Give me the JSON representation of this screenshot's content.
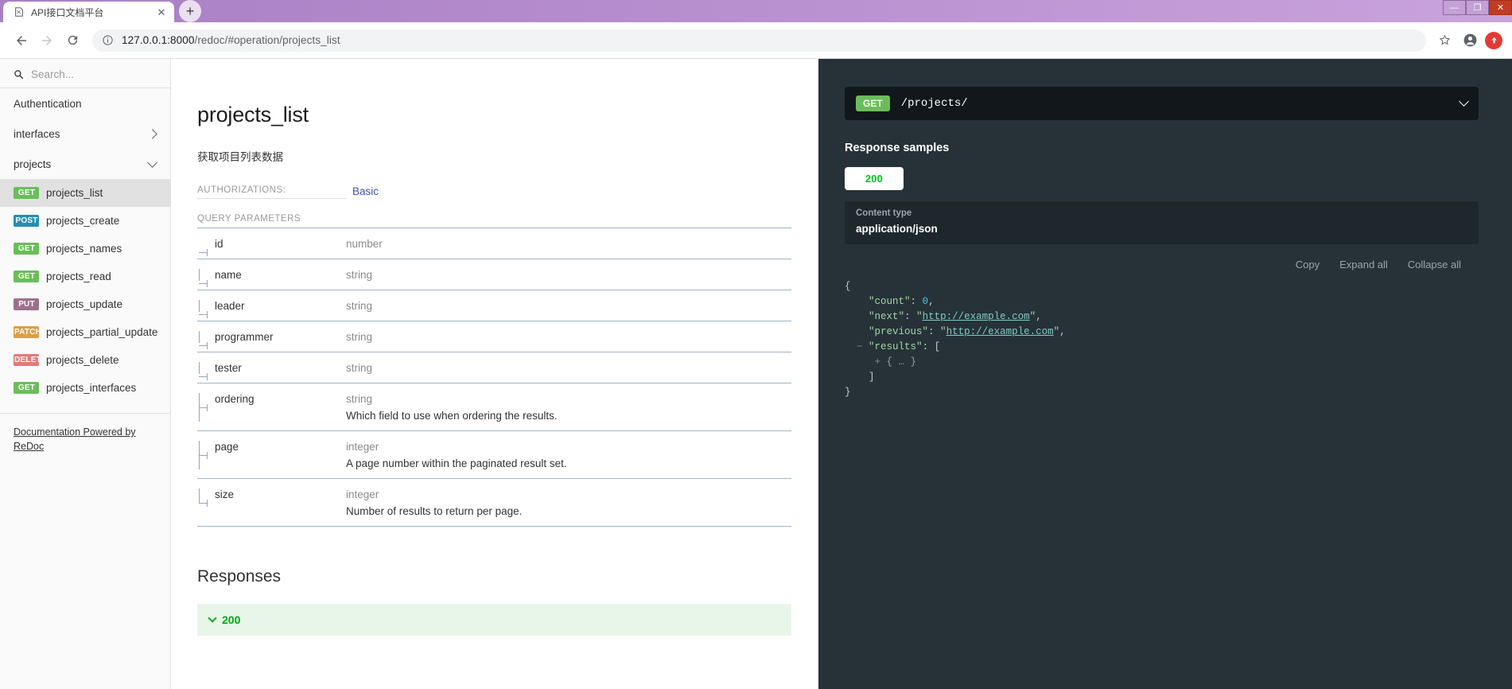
{
  "browser": {
    "tab_title": "API接口文档平台",
    "tab_favicon_name": "page-icon",
    "close_label": "✕",
    "newtab_label": "+",
    "url_host": "127.0.0.1:8000",
    "url_path": "/redoc/#operation/projects_list",
    "back_label": "←",
    "forward_label": "→",
    "reload_label": "⟳",
    "bookmark_label": "☆",
    "window_minimize": "—",
    "window_maximize": "❐",
    "window_close": "✕"
  },
  "sidebar": {
    "search_placeholder": "Search...",
    "groups": [
      {
        "label": "Authentication",
        "chevron": "none"
      },
      {
        "label": "interfaces",
        "chevron": "right"
      },
      {
        "label": "projects",
        "chevron": "down"
      }
    ],
    "operations": [
      {
        "method": "GET",
        "method_class": "m-get",
        "label": "projects_list",
        "active": true
      },
      {
        "method": "POST",
        "method_class": "m-post",
        "label": "projects_create",
        "active": false
      },
      {
        "method": "GET",
        "method_class": "m-get",
        "label": "projects_names",
        "active": false
      },
      {
        "method": "GET",
        "method_class": "m-get",
        "label": "projects_read",
        "active": false
      },
      {
        "method": "PUT",
        "method_class": "m-put",
        "label": "projects_update",
        "active": false
      },
      {
        "method": "PATCH",
        "method_class": "m-patch",
        "label": "projects_partial_update",
        "active": false
      },
      {
        "method": "DELETE",
        "method_class": "m-delete",
        "label": "projects_delete",
        "active": false
      },
      {
        "method": "GET",
        "method_class": "m-get",
        "label": "projects_interfaces",
        "active": false
      }
    ],
    "footer_link": "Documentation Powered by ReDoc"
  },
  "main": {
    "title": "projects_list",
    "description": "获取项目列表数据",
    "authorizations_label": "AUTHORIZATIONS:",
    "authorizations_value": "Basic",
    "query_parameters_label": "QUERY PARAMETERS",
    "parameters": [
      {
        "name": "id",
        "type": "number",
        "desc": ""
      },
      {
        "name": "name",
        "type": "string",
        "desc": ""
      },
      {
        "name": "leader",
        "type": "string",
        "desc": ""
      },
      {
        "name": "programmer",
        "type": "string",
        "desc": ""
      },
      {
        "name": "tester",
        "type": "string",
        "desc": ""
      },
      {
        "name": "ordering",
        "type": "string",
        "desc": "Which field to use when ordering the results."
      },
      {
        "name": "page",
        "type": "integer",
        "desc": "A page number within the paginated result set."
      },
      {
        "name": "size",
        "type": "integer",
        "desc": "Number of results to return per page."
      }
    ],
    "responses_title": "Responses",
    "response_status": "200"
  },
  "right_panel": {
    "endpoint_method": "GET",
    "endpoint_path": "/projects/",
    "response_samples_title": "Response samples",
    "status_tab": "200",
    "content_type_label": "Content type",
    "content_type_value": "application/json",
    "actions": {
      "copy": "Copy",
      "expand_all": "Expand all",
      "collapse_all": "Collapse all"
    },
    "sample": {
      "count_key": "\"count\"",
      "count_value": "0",
      "next_key": "\"next\"",
      "next_value": "http://example.com",
      "previous_key": "\"previous\"",
      "previous_value": "http://example.com",
      "results_key": "\"results\"",
      "results_fold": "{ … }",
      "open_brace": "{",
      "close_brace": "}",
      "open_bracket": "[",
      "close_bracket": "]",
      "minus": "−",
      "plus": "+"
    }
  }
}
